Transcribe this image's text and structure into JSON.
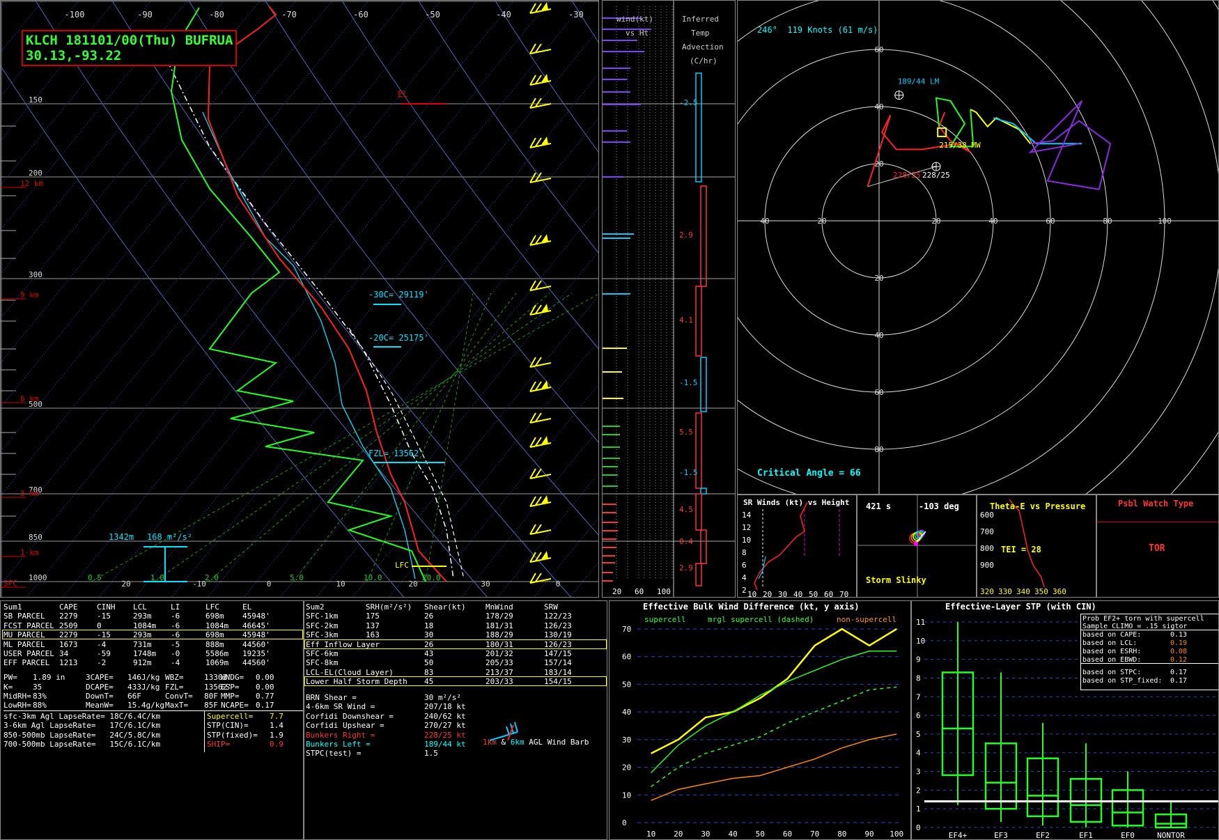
{
  "header": {
    "line1": "KLCH 181101/00(Thu) BUFRUA",
    "line2": "30.13,-93.22"
  },
  "colors": {
    "temperature": "#ff2020",
    "dewpoint": "#20ff20",
    "wetbulb": "#00e5ff",
    "wind_barb": "#ffff00",
    "background": "#000000",
    "frame": "#888888"
  },
  "skewt": {
    "temp_ticks": [
      "-100",
      "-90",
      "-80",
      "-70",
      "-60",
      "-50",
      "-40",
      "-30"
    ],
    "pressure_labels": [
      "150",
      "200",
      "300",
      "500",
      "700",
      "850",
      "1000"
    ],
    "height_labels": [
      "12 km",
      "9 km",
      "6 km",
      "3 km",
      "1 km",
      "SFC"
    ],
    "bottom_ticks": [
      "20",
      "-10",
      "0",
      "10",
      "20",
      "30",
      "0"
    ],
    "mixing_ratio_labels": [
      "0.5",
      "1.0",
      "2.0",
      "5.0",
      "10.0",
      "20.0"
    ],
    "el_label": "EL",
    "lfc_label": "LFC",
    "levels": [
      {
        "label": "-30C= 29119'"
      },
      {
        "label": "-20C= 25175'"
      },
      {
        "label": "FZL= 13562'"
      }
    ],
    "helicity_label": "1342m",
    "helicity_value": "168 m²/s²"
  },
  "wind_height": {
    "title_line1": "wind(kt)",
    "title_line2": "vs Ht",
    "axis": [
      "20",
      "60",
      "100"
    ]
  },
  "temp_advection": {
    "title": [
      "Inferred",
      "Temp",
      "Advection",
      "(C/hr)"
    ],
    "values": [
      "-2.5",
      "2.9",
      "4.1",
      "-1.5",
      "5.5",
      "-1.5",
      "4.5",
      "0.4",
      "2.9"
    ]
  },
  "hodograph": {
    "title": "246°  119 Knots (61 m/s)",
    "ring_labels_x": [
      "40",
      "20",
      "20",
      "40",
      "60",
      "80",
      "100"
    ],
    "ring_labels_y": [
      "60",
      "40",
      "20",
      "20",
      "40",
      "60",
      "80"
    ],
    "lm_label": "189/44 LM",
    "mw_label": "215/38 MW",
    "rm_label": "228/25",
    "rm_label_red": "228/25",
    "critical_angle": "Critical Angle = 66"
  },
  "sr_winds": {
    "title": "SR Winds (kt) vs Height",
    "y_ticks": [
      "14",
      "12",
      "10",
      "8",
      "6",
      "4",
      "2"
    ],
    "x_ticks": [
      "10",
      "20",
      "30",
      "40",
      "50",
      "60",
      "70"
    ]
  },
  "storm_slinky": {
    "time": "421 s",
    "angle": "-103 deg",
    "label": "Storm Slinky"
  },
  "theta_e": {
    "title": "Theta-E vs Pressure",
    "y_ticks": [
      "600",
      "700",
      "800",
      "900"
    ],
    "x_ticks": [
      "320",
      "330",
      "340",
      "350",
      "360"
    ],
    "tei": "TEI = 28"
  },
  "watch": {
    "title": "Psbl Watch Type",
    "value": "TOR"
  },
  "sum1": {
    "headers": [
      "Sum1",
      "CAPE",
      "CINH",
      "LCL",
      "LI",
      "LFC",
      "EL"
    ],
    "rows": [
      [
        "SB PARCEL",
        "2279",
        "-15",
        "293m",
        "-6",
        "698m",
        "45948'"
      ],
      [
        "FCST PARCEL",
        "2509",
        "0",
        "1084m",
        "-6",
        "1084m",
        "46645'"
      ],
      [
        "MU PARCEL",
        "2279",
        "-15",
        "293m",
        "-6",
        "698m",
        "45948'"
      ],
      [
        "ML PARCEL",
        "1673",
        "-4",
        "731m",
        "-5",
        "888m",
        "44560'"
      ],
      [
        "USER PARCEL",
        "34",
        "-59",
        "1748m",
        "-0",
        "5586m",
        "19235'"
      ],
      [
        "EFF PARCEL",
        "1213",
        "-2",
        "912m",
        "-4",
        "1069m",
        "44560'"
      ]
    ],
    "misc": [
      [
        "PW=",
        "1.89 in",
        "3CAPE=",
        "146J/kg",
        "WBZ=",
        "13303'",
        "WNDG=",
        "0.00"
      ],
      [
        "K=",
        "35",
        "DCAPE=",
        "433J/kg",
        "FZL=",
        "13562'",
        "ESP=",
        "0.00"
      ],
      [
        "MidRH=",
        "83%",
        "DownT=",
        "66F",
        "ConvT=",
        "80F",
        "MMP=",
        "0.77"
      ],
      [
        "LowRH=",
        "88%",
        "MeanW=",
        "15.4g/kg",
        "MaxT=",
        "85F",
        "NCAPE=",
        "0.17"
      ]
    ],
    "lapse": [
      "sfc-3km Agl LapseRate= 18C/6.4C/km",
      "3-6km Agl LapseRate=   17C/6.1C/km",
      "850-500mb LapseRate=   24C/5.8C/km",
      "700-500mb LapseRate=   15C/6.1C/km"
    ],
    "composite": [
      [
        "Supercell=",
        "7.7"
      ],
      [
        "STP(CIN)=",
        "1.4"
      ],
      [
        "STP(fixed)=",
        "1.9"
      ],
      [
        "SHIP=",
        "0.9"
      ]
    ]
  },
  "sum2": {
    "headers": [
      "Sum2",
      "SRH(m²/s²)",
      "Shear(kt)",
      "MnWind",
      "SRW"
    ],
    "rows": [
      [
        "SFC-1km",
        "175",
        "26",
        "178/29",
        "122/23"
      ],
      [
        "SFC-2km",
        "137",
        "18",
        "181/31",
        "126/23"
      ],
      [
        "SFC-3km",
        "163",
        "30",
        "188/29",
        "130/19"
      ],
      [
        "Eff Inflow Layer",
        "",
        "26",
        "180/31",
        "126/23"
      ],
      [
        "SFC-6km",
        "",
        "43",
        "201/32",
        "147/15"
      ],
      [
        "SFC-8km",
        "",
        "50",
        "205/33",
        "157/14"
      ],
      [
        "LCL-EL(Cloud Layer)",
        "",
        "83",
        "213/37",
        "183/14"
      ],
      [
        "Lower Half Storm Depth",
        "",
        "45",
        "203/33",
        "154/15"
      ]
    ],
    "extras": [
      [
        "BRN Shear =",
        "30 m²/s²"
      ],
      [
        "4-6km SR Wind =",
        "207/18 kt"
      ],
      [
        "Corfidi Downshear =",
        "240/62 kt"
      ],
      [
        "Corfidi Upshear =",
        "270/27 kt"
      ],
      [
        "Bunkers Right =",
        "228/25 kt"
      ],
      [
        "Bunkers Left =",
        "189/44 kt"
      ],
      [
        "STPC(test) =",
        "1.5"
      ]
    ],
    "barb_legend_1km": "1km",
    "barb_legend_amp": "&",
    "barb_legend_6km": "6km",
    "barb_legend_rest": "AGL Wind Barb"
  },
  "ebwd": {
    "title": "Effective Bulk Wind Difference (kt, y axis)",
    "legend": [
      "supercell",
      "mrgl supercell (dashed)",
      "non-supercell"
    ]
  },
  "stp_box": {
    "title": "Effective-Layer STP (with CIN)",
    "prob_line1": "Prob EF2+ torn with supercell",
    "prob_line2": "Sample CLIMO = .15 sigtor",
    "rows": [
      [
        "based on CAPE:",
        "0.13"
      ],
      [
        "based on LCL:",
        "0.19"
      ],
      [
        "based on ESRH:",
        "0.08"
      ],
      [
        "based on EBWD:",
        "0.12"
      ],
      [
        "based on STPC:",
        "0.17"
      ],
      [
        "based on STP_fixed:",
        "0.17"
      ]
    ]
  },
  "chart_data": [
    {
      "type": "line",
      "title": "Effective Bulk Wind Difference (kt, y axis)",
      "x": [
        10,
        20,
        30,
        40,
        50,
        60,
        70,
        80,
        90,
        100
      ],
      "ylim": [
        0,
        70
      ],
      "series": [
        {
          "name": "supercell",
          "values": [
            25,
            30,
            38,
            40,
            45,
            52,
            64,
            70,
            64,
            70
          ]
        },
        {
          "name": "mrgl supercell (dashed)",
          "values": [
            13,
            20,
            25,
            28,
            31,
            36,
            40,
            44,
            48,
            49
          ]
        },
        {
          "name": "non-supercell",
          "values": [
            8,
            12,
            14,
            16,
            17,
            20,
            23,
            27,
            30,
            32
          ]
        },
        {
          "name": "",
          "values": [
            18,
            28,
            35,
            40,
            46,
            51,
            55,
            59,
            62,
            62
          ]
        }
      ]
    },
    {
      "type": "box",
      "title": "Effective-Layer STP (with CIN)",
      "categories": [
        "EF4+",
        "EF3",
        "EF2",
        "EF1",
        "EF0",
        "NONTOR"
      ],
      "ylim": [
        0,
        11
      ],
      "boxes": [
        {
          "min": 1.2,
          "q1": 2.8,
          "median": 5.3,
          "q3": 8.3,
          "max": 11.0
        },
        {
          "min": 0.3,
          "q1": 1.0,
          "median": 2.4,
          "q3": 4.5,
          "max": 8.3
        },
        {
          "min": 0.1,
          "q1": 0.6,
          "median": 1.7,
          "q3": 3.7,
          "max": 5.6
        },
        {
          "min": 0.0,
          "q1": 0.3,
          "median": 1.2,
          "q3": 2.6,
          "max": 4.5
        },
        {
          "min": 0.0,
          "q1": 0.1,
          "median": 0.8,
          "q3": 2.0,
          "max": 3.0
        },
        {
          "min": 0.0,
          "q1": 0.0,
          "median": 0.2,
          "q3": 0.7,
          "max": 1.4
        }
      ],
      "reference_value": 1.4
    }
  ]
}
